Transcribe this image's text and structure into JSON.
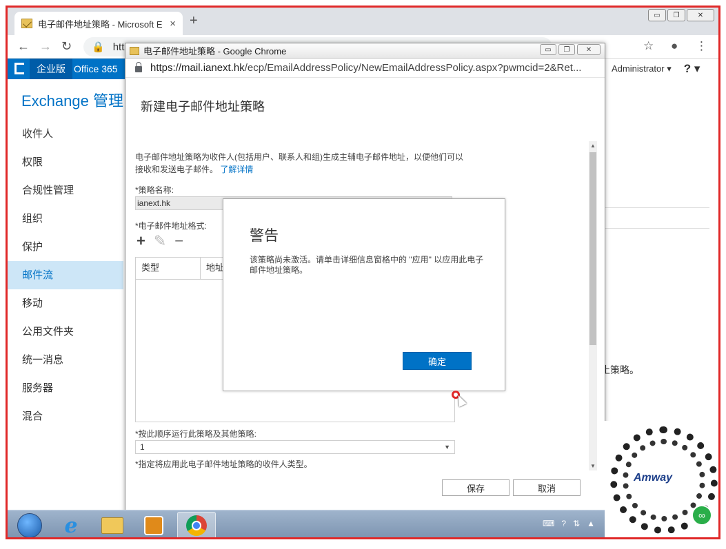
{
  "browser": {
    "tab_title": "电子邮件地址策略 - Microsoft E",
    "tab_close": "×",
    "new_tab": "+",
    "url_partial": "http",
    "win_min": "▭",
    "win_max": "❐",
    "win_close": "✕"
  },
  "exchange": {
    "nav_enterprise": "企业版",
    "nav_office365": "Office 365",
    "admin_user": "Administrator ▾",
    "help": "? ▾",
    "app_title": "Exchange 管理中",
    "sidebar": [
      {
        "label": "收件人"
      },
      {
        "label": "权限"
      },
      {
        "label": "合规性管理"
      },
      {
        "label": "组织"
      },
      {
        "label": "保护"
      },
      {
        "label": "邮件流",
        "active": true
      },
      {
        "label": "移动"
      },
      {
        "label": "公用文件夹"
      },
      {
        "label": "统一消息"
      },
      {
        "label": "服务器"
      },
      {
        "label": "混合"
      }
    ],
    "right_partial_text": "止策略。"
  },
  "popup": {
    "window_title": "电子邮件地址策略 - Google Chrome",
    "url_host": "https://mail.ianext.hk",
    "url_path": "/ecp/EmailAddressPolicy/NewEmailAddressPolicy.aspx?pwmcid=2&Ret...",
    "page_title": "新建电子邮件地址策略",
    "intro_text": "电子邮件地址策略为收件人(包括用户、联系人和组)生成主辅电子邮件地址，以便他们可以接收和发送电子邮件。",
    "learn_more": "了解详情",
    "policy_name_label": "*策略名称:",
    "policy_name_value": "ianext.hk",
    "format_label": "*电子邮件地址格式:",
    "tool_add": "+",
    "tool_edit": "✎",
    "tool_remove": "−",
    "col_type": "类型",
    "col_address": "地址",
    "order_label": "*按此顺序运行此策略及其他策略:",
    "order_value": "1",
    "order_arrow": "▼",
    "recipient_label": "*指定将应用此电子邮件地址策略的收件人类型。",
    "save": "保存",
    "cancel": "取消",
    "scroll_up": "▲",
    "scroll_down": "▼"
  },
  "dialog": {
    "title": "警告",
    "message": "该策略尚未激活。请单击详细信息窗格中的 \"应用\" 以应用此电子邮件地址策略。",
    "ok": "确定"
  },
  "overlay": {
    "logo_text": "Amway"
  },
  "colors": {
    "accent": "#0072c6",
    "frame": "#e02828"
  }
}
